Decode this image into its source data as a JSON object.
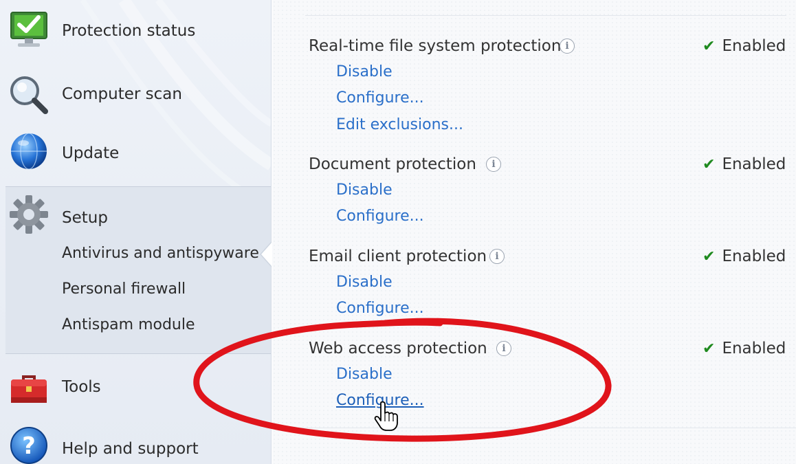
{
  "sidebar": {
    "items": [
      {
        "label": "Protection status",
        "icon": "monitor-check-icon"
      },
      {
        "label": "Computer scan",
        "icon": "magnifier-icon"
      },
      {
        "label": "Update",
        "icon": "globe-icon"
      },
      {
        "label": "Setup",
        "icon": "gear-icon"
      },
      {
        "label": "Tools",
        "icon": "toolbox-icon"
      },
      {
        "label": "Help and support",
        "icon": "help-icon"
      }
    ],
    "setup_subitems": [
      {
        "label": "Antivirus and antispyware",
        "active": true
      },
      {
        "label": "Personal firewall"
      },
      {
        "label": "Antispam module"
      }
    ]
  },
  "modules": [
    {
      "title": "Real-time file system protection",
      "status": "Enabled",
      "links": [
        "Disable",
        "Configure...",
        "Edit exclusions..."
      ]
    },
    {
      "title": "Document protection",
      "status": "Enabled",
      "links": [
        "Disable",
        "Configure..."
      ]
    },
    {
      "title": "Email client protection",
      "status": "Enabled",
      "links": [
        "Disable",
        "Configure..."
      ]
    },
    {
      "title": "Web access protection",
      "status": "Enabled",
      "links": [
        "Disable",
        "Configure..."
      ]
    }
  ],
  "info_icon_glyph": "i",
  "check_glyph": "✔",
  "colors": {
    "link": "#2a6fc9",
    "check": "#1f8a1f",
    "annotation": "#e0141b"
  }
}
